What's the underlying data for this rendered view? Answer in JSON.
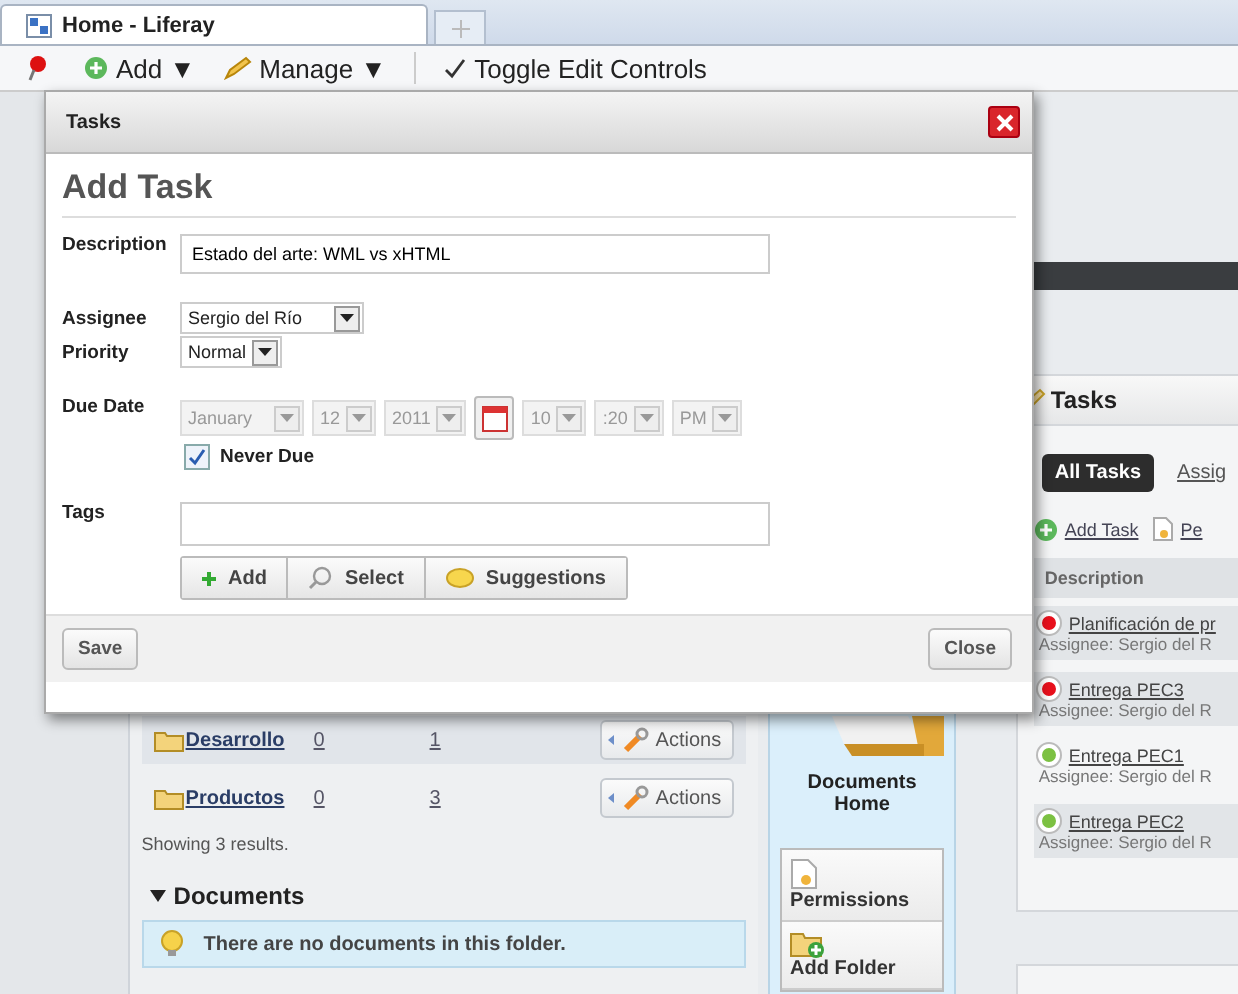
{
  "browser": {
    "tabs": [
      {
        "title": "Home - Liferay",
        "selected": true
      }
    ]
  },
  "toolbar": {
    "items": [
      {
        "kind": "add",
        "label": "Add",
        "caret": "▼"
      },
      {
        "kind": "manage",
        "label": "Manage",
        "caret": "▼"
      },
      {
        "kind": "toggle",
        "label": "Toggle Edit Controls"
      }
    ]
  },
  "folders": {
    "rows": [
      {
        "name": "Desarrollo",
        "column_2": "0",
        "column_3": "1",
        "action": "Actions"
      },
      {
        "name": "Productos",
        "column_2": "0",
        "column_3": "3",
        "action": "Actions"
      }
    ],
    "results": "Showing 3 results."
  },
  "documents": {
    "heading": "Documents",
    "expanded": true,
    "message": "There are no documents in this folder."
  },
  "documents_home": {
    "label": "Documents Home",
    "actions": [
      {
        "kind": "permissions",
        "label": "Permissions"
      },
      {
        "kind": "add-folder",
        "label": "Add Folder"
      }
    ]
  },
  "tasks_portlet": {
    "title": "Tasks",
    "tabs": [
      {
        "label": "All Tasks",
        "selected": true
      },
      {
        "label": "Assig",
        "selected": false
      }
    ],
    "actions": [
      {
        "kind": "add",
        "label": "Add Task"
      },
      {
        "kind": "permissions",
        "label": "Pe"
      }
    ],
    "column": "Description",
    "tasks": [
      {
        "title": "Planificación de pr",
        "assignee": "Assignee: Sergio del R",
        "color": "#e8101c"
      },
      {
        "title": "Entrega PEC3",
        "assignee": "Assignee: Sergio del R",
        "color": "#e8101c"
      },
      {
        "title": "Entrega PEC1",
        "assignee": "Assignee: Sergio del R",
        "color": "#7cc142"
      },
      {
        "title": "Entrega PEC2",
        "assignee": "Assignee: Sergio del R",
        "color": "#7cc142"
      }
    ]
  },
  "dialog": {
    "title": "Tasks",
    "heading": "Add Task",
    "description": {
      "label": "Description",
      "value": "Estado del arte: WML vs xHTML"
    },
    "assignee": {
      "label": "Assignee",
      "value": "Sergio del Río"
    },
    "priority": {
      "label": "Priority",
      "value": "Normal"
    },
    "due_date": {
      "label": "Due Date",
      "disabled": true,
      "month": "January",
      "day": "12",
      "year": "2011",
      "hour": "10",
      "minute": ":20",
      "ampm": "PM"
    },
    "never_due": {
      "label": "Never Due",
      "checked": true
    },
    "tags": {
      "label": "Tags",
      "buttons": [
        {
          "kind": "add",
          "label": "Add"
        },
        {
          "kind": "select",
          "label": "Select"
        },
        {
          "kind": "suggestions",
          "label": "Suggestions"
        }
      ]
    },
    "save": "Save",
    "close": "Close"
  }
}
